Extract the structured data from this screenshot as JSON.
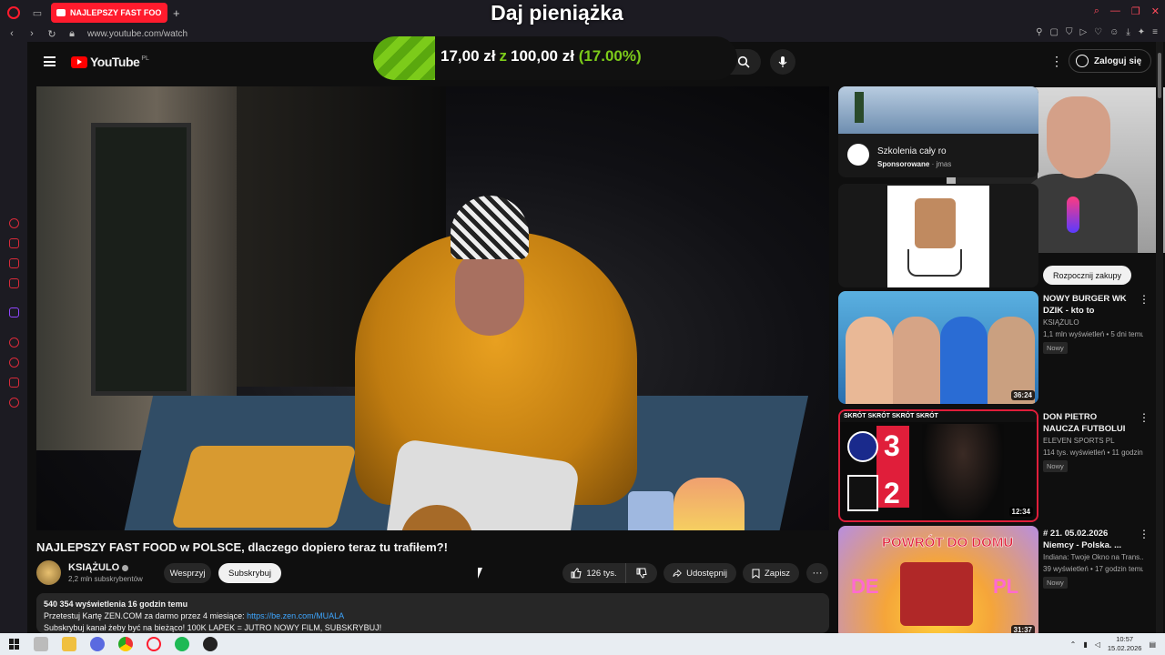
{
  "browser": {
    "tab_title": "NAJLEPSZY FAST FOO",
    "new_tab": "+",
    "url": "www.youtube.com/watch"
  },
  "overlay": {
    "donation_title": "Daj pieniążka",
    "goal_current": "17,00 zł",
    "goal_separator": "z",
    "goal_target": "100,00 zł",
    "goal_percent": "(17.00%)",
    "goal_fraction": 0.17
  },
  "youtube": {
    "logo_text": "YouTube",
    "region": "PL",
    "sign_in": "Zaloguj się"
  },
  "video": {
    "title": "NAJLEPSZY FAST FOOD w POLSCE, dlaczego dopiero teraz tu trafiłem?!",
    "channel_name": "KSIĄŻULO",
    "channel_subs": "2,2 mln subskrybentów",
    "support_label": "Wesprzyj",
    "subscribe_label": "Subskrybuj",
    "likes": "126 tys.",
    "share_label": "Udostępnij",
    "save_label": "Zapisz",
    "more_label": "···"
  },
  "description": {
    "meta": "540 354 wyświetlenia  16 godzin temu",
    "line1_text": "Przetestuj Kartę ZEN.COM za darmo przez 4 miesiące: ",
    "line1_link": "https://be.zen.com/MUALA",
    "line2": "Subskrybuj kanał żeby być na bieżąco! 100K LAPEK = JUTRO NOWY FILM, SUBSKRYBUJ!"
  },
  "ad": {
    "title": "Szkolenia cały ro",
    "sponsored": "Sponsorowane",
    "advertiser": " · jmas"
  },
  "shop": {
    "button": "Rozpocznij zakupy"
  },
  "recommendations": [
    {
      "title": "NOWY BURGER WK DZIK - kto to kupuje?",
      "channel": "KSIĄŻULO",
      "meta": "1,1 mln wyświetleń • 5 dni temu",
      "badge": "Nowy",
      "duration": "36:24"
    },
    {
      "title": "DON PIETRO NAUCZA FUTBOLUI ZIELU ...",
      "channel": "ELEVEN SPORTS PL",
      "meta": "114 tys. wyświetleń • 11 godzin temu",
      "badge": "Nowy",
      "duration": "12:34",
      "thumb_strip": "SKRÓT SKRÓT SKRÓT SKRÓT",
      "score_home": "3",
      "score_away": "2"
    },
    {
      "title": "# 21.  05.02.2026 Niemcy - Polska. ...",
      "channel": "Indiana: Twoje Okno na Trans...",
      "meta": "39 wyświetleń • 17 godzin temu",
      "badge": "Nowy",
      "duration": "31:37",
      "thumb_word": "POWRÓT DO DOMU",
      "thumb_left": "DE",
      "thumb_right": "PL"
    }
  ],
  "taskbar": {
    "time": "10:57",
    "date": "15.02.2026"
  },
  "colors": {
    "opera_red": "#ff1b2d",
    "goal_green": "#7ccb1a",
    "yt_red": "#ff0000",
    "link_blue": "#3ea6ff"
  }
}
